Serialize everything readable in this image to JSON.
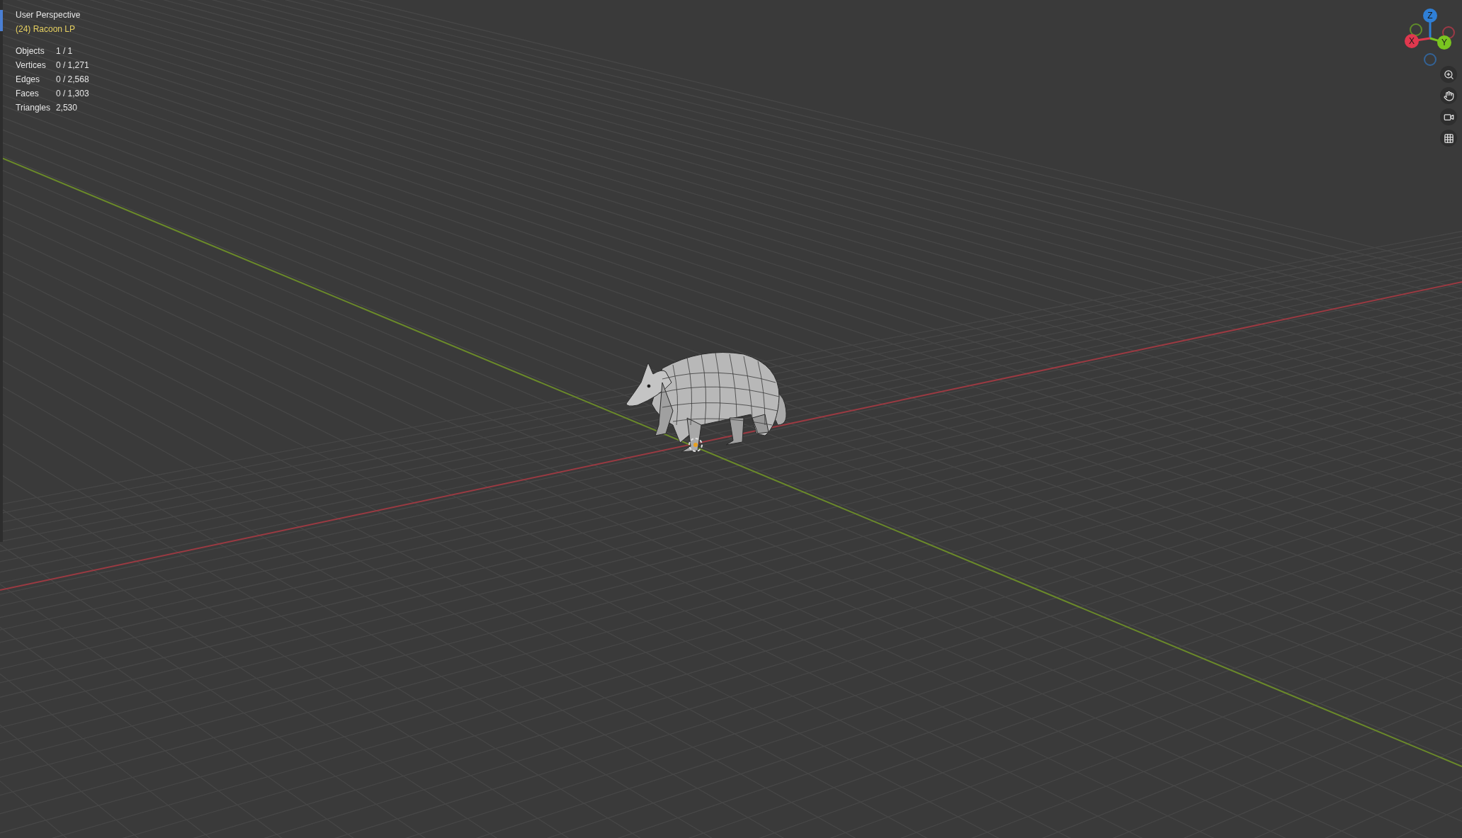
{
  "viewport": {
    "view_name": "User Perspective",
    "active_object": "(24) Racoon LP"
  },
  "stats": [
    {
      "label": "Objects",
      "value": "1 / 1"
    },
    {
      "label": "Vertices",
      "value": "0 / 1,271"
    },
    {
      "label": "Edges",
      "value": "0 / 2,568"
    },
    {
      "label": "Faces",
      "value": "0 / 1,303"
    },
    {
      "label": "Triangles",
      "value": "2,530"
    }
  ],
  "gizmo": {
    "axes": [
      {
        "label": "Z",
        "color": "#2f7fd6"
      },
      {
        "label": "X",
        "color": "#e0384e"
      },
      {
        "label": "Y",
        "color": "#7ac520"
      }
    ]
  }
}
